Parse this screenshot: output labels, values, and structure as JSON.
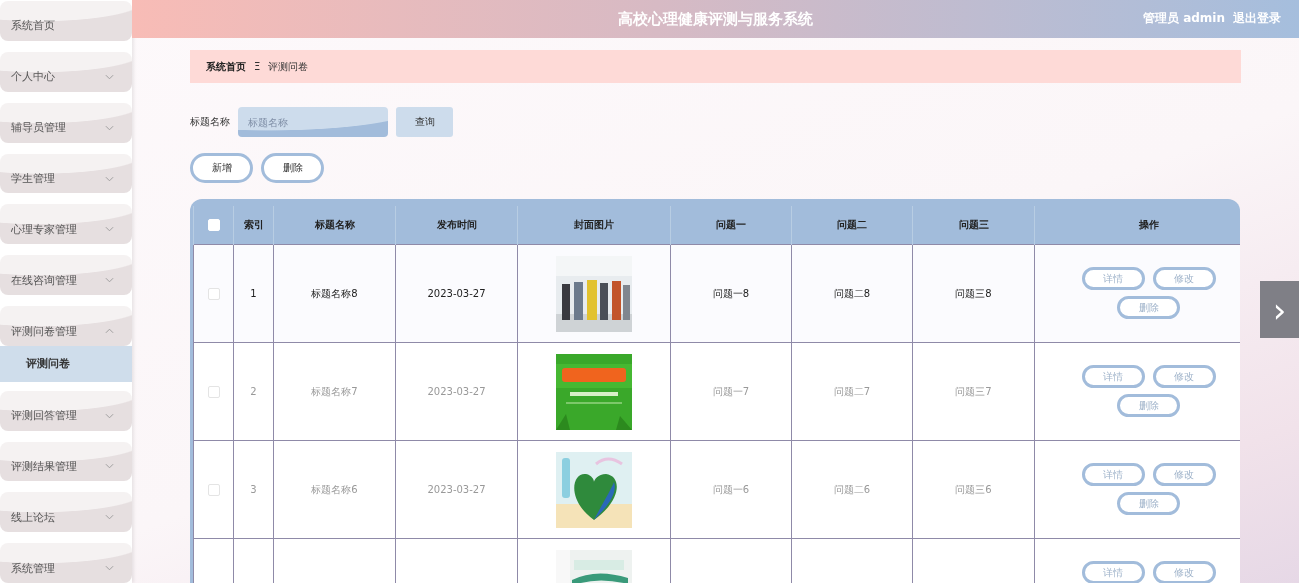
{
  "header": {
    "title": "高校心理健康评测与服务系统",
    "user": "管理员 admin",
    "logout": "退出登录"
  },
  "sidebar": {
    "items": [
      {
        "label": "系统首页",
        "expandable": false,
        "expanded": false
      },
      {
        "label": "个人中心",
        "expandable": true,
        "expanded": false
      },
      {
        "label": "辅导员管理",
        "expandable": true,
        "expanded": false
      },
      {
        "label": "学生管理",
        "expandable": true,
        "expanded": false
      },
      {
        "label": "心理专家管理",
        "expandable": true,
        "expanded": false
      },
      {
        "label": "在线咨询管理",
        "expandable": true,
        "expanded": false
      },
      {
        "label": "评测问卷管理",
        "expandable": true,
        "expanded": true,
        "children": [
          {
            "label": "评测问卷",
            "selected": true
          }
        ]
      },
      {
        "label": "评测回答管理",
        "expandable": true,
        "expanded": false
      },
      {
        "label": "评测结果管理",
        "expandable": true,
        "expanded": false
      },
      {
        "label": "线上论坛",
        "expandable": true,
        "expanded": false
      },
      {
        "label": "系统管理",
        "expandable": true,
        "expanded": false
      }
    ]
  },
  "breadcrumb": {
    "home": "系统首页",
    "separator": "Ξ",
    "current": "评测问卷"
  },
  "search": {
    "label": "标题名称",
    "placeholder": "标题名称",
    "button": "查询"
  },
  "actions": [
    "新增",
    "删除"
  ],
  "table": {
    "all_checked": false,
    "columns": [
      "索引",
      "标题名称",
      "发布时间",
      "封面图片",
      "问题一",
      "问题二",
      "问题三",
      "操作"
    ],
    "rows": [
      {
        "checked": false,
        "hovered": true,
        "cells": [
          "1",
          "标题名称8",
          "2023-03-27",
          "",
          "问题一8",
          "问题二8",
          "问题三8"
        ],
        "buttons": [
          "详情",
          "修改",
          "删除"
        ]
      },
      {
        "checked": false,
        "hovered": false,
        "cells": [
          "2",
          "标题名称7",
          "2023-03-27",
          "",
          "问题一7",
          "问题二7",
          "问题三7"
        ],
        "buttons": [
          "详情",
          "修改",
          "删除"
        ]
      },
      {
        "checked": false,
        "hovered": false,
        "cells": [
          "3",
          "标题名称6",
          "2023-03-27",
          "",
          "问题一6",
          "问题二6",
          "问题三6"
        ],
        "buttons": [
          "详情",
          "修改",
          "删除"
        ]
      },
      {
        "cells": [],
        "buttons": [
          "详情",
          "修改"
        ]
      }
    ]
  },
  "next_button": "›"
}
